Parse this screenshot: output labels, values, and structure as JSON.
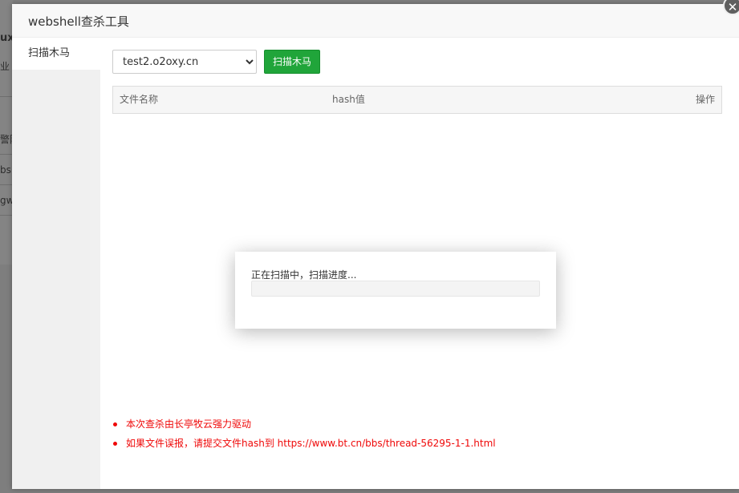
{
  "background": {
    "fragments": [
      "ux",
      "业",
      "警防",
      "bsh",
      "gw"
    ]
  },
  "modal": {
    "title": "webshell查杀工具",
    "close_icon": "close-icon"
  },
  "sidebar": {
    "items": [
      {
        "label": "扫描木马"
      }
    ]
  },
  "toolbar": {
    "site_select": {
      "selected": "test2.o2oxy.cn",
      "options": [
        "test2.o2oxy.cn"
      ]
    },
    "scan_button": "扫描木马"
  },
  "table": {
    "headers": [
      "文件名称",
      "hash值",
      "操作"
    ],
    "rows": []
  },
  "notes": [
    "本次查杀由长亭牧云强力驱动",
    "如果文件误报，请提交文件hash到 https://www.bt.cn/bbs/thread-56295-1-1.html"
  ],
  "progress": {
    "label": "正在扫描中，扫描进度...",
    "value": 0
  },
  "colors": {
    "accent": "#20a53a",
    "note": "#ef0808"
  }
}
